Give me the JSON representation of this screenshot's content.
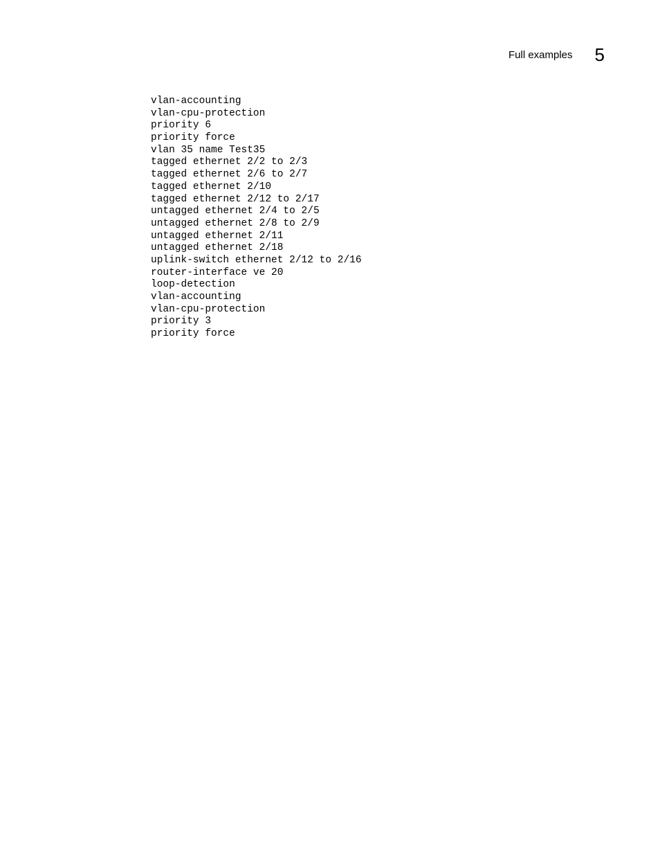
{
  "header": {
    "section_title": "Full examples",
    "chapter_number": "5"
  },
  "code": {
    "lines": [
      "vlan-accounting",
      "vlan-cpu-protection",
      "priority 6",
      "priority force",
      "vlan 35 name Test35",
      "tagged ethernet 2/2 to 2/3",
      "tagged ethernet 2/6 to 2/7",
      "tagged ethernet 2/10",
      "tagged ethernet 2/12 to 2/17",
      "untagged ethernet 2/4 to 2/5",
      "untagged ethernet 2/8 to 2/9",
      "untagged ethernet 2/11",
      "untagged ethernet 2/18",
      "uplink-switch ethernet 2/12 to 2/16",
      "router-interface ve 20",
      "loop-detection",
      "vlan-accounting",
      "vlan-cpu-protection",
      "priority 3",
      "priority force"
    ]
  }
}
